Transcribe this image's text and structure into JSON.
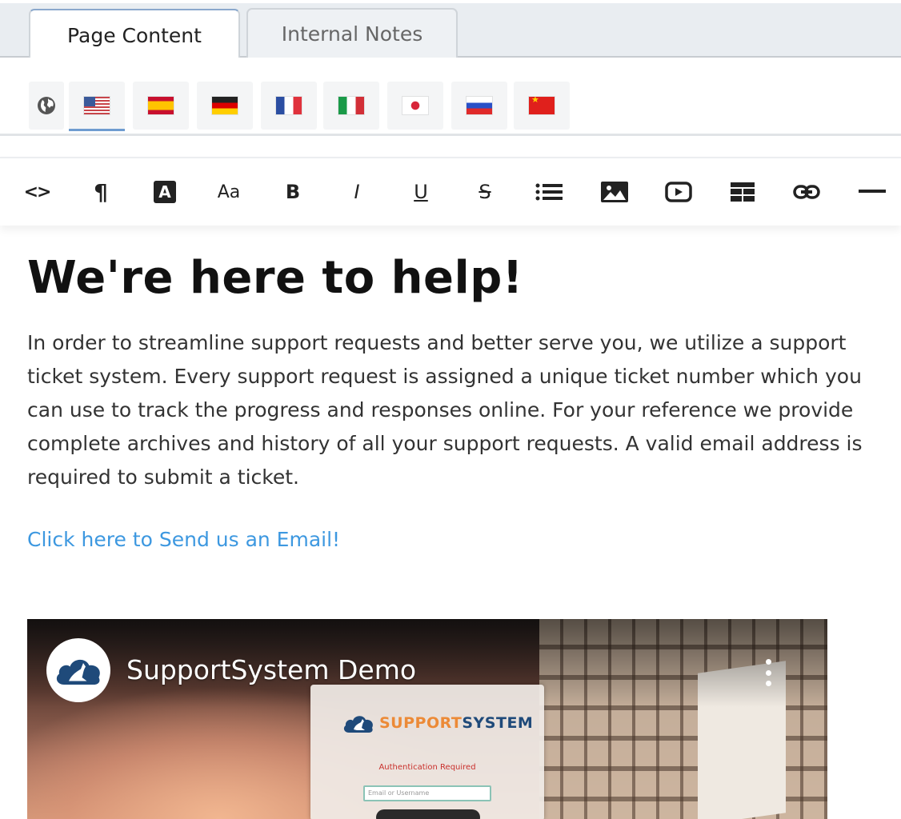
{
  "tabs": [
    {
      "label": "Page Content",
      "active": true
    },
    {
      "label": "Internal Notes",
      "active": false
    }
  ],
  "languages": [
    {
      "icon": "globe-icon"
    },
    {
      "icon": "flag-us-icon",
      "active": true
    },
    {
      "icon": "flag-es-icon"
    },
    {
      "icon": "flag-de-icon"
    },
    {
      "icon": "flag-fr-icon"
    },
    {
      "icon": "flag-it-icon"
    },
    {
      "icon": "flag-jp-icon"
    },
    {
      "icon": "flag-ru-icon"
    },
    {
      "icon": "flag-cn-icon"
    }
  ],
  "toolbar": {
    "buttons": [
      "code-view-icon",
      "paragraph-icon",
      "text-color-icon",
      "font-size-icon",
      "bold-icon",
      "italic-icon",
      "underline-icon",
      "strikethrough-icon",
      "list-icon",
      "image-icon",
      "video-icon",
      "table-icon",
      "link-icon",
      "horizontal-rule-icon"
    ],
    "bold_glyph": "B",
    "italic_glyph": "I",
    "underline_glyph": "U",
    "strike_glyph": "S",
    "font_size_glyph": "Aa",
    "paragraph_glyph": "¶",
    "code_glyph": "<>",
    "text_color_glyph": "A"
  },
  "content": {
    "heading": "We're here to help!",
    "paragraph": "In order to streamline support requests and better serve you, we utilize a support ticket system. Every support request is assigned a unique ticket number which you can use to track the progress and responses online. For your reference we provide complete archives and history of all your support requests. A valid email address is required to submit a ticket.",
    "link_text": "Click here to Send us an Email!"
  },
  "video": {
    "title": "SupportSystem Demo",
    "card_logo_part1": "SUPPORT",
    "card_logo_part2": "SYSTEM",
    "card_auth_text": "Authentication Required",
    "card_input_placeholder": "Email or Username"
  },
  "colors": {
    "link": "#3d98e0",
    "active_underline": "#6e9cd0",
    "brand_orange": "#ec8a37",
    "brand_blue": "#1f4a7a"
  }
}
